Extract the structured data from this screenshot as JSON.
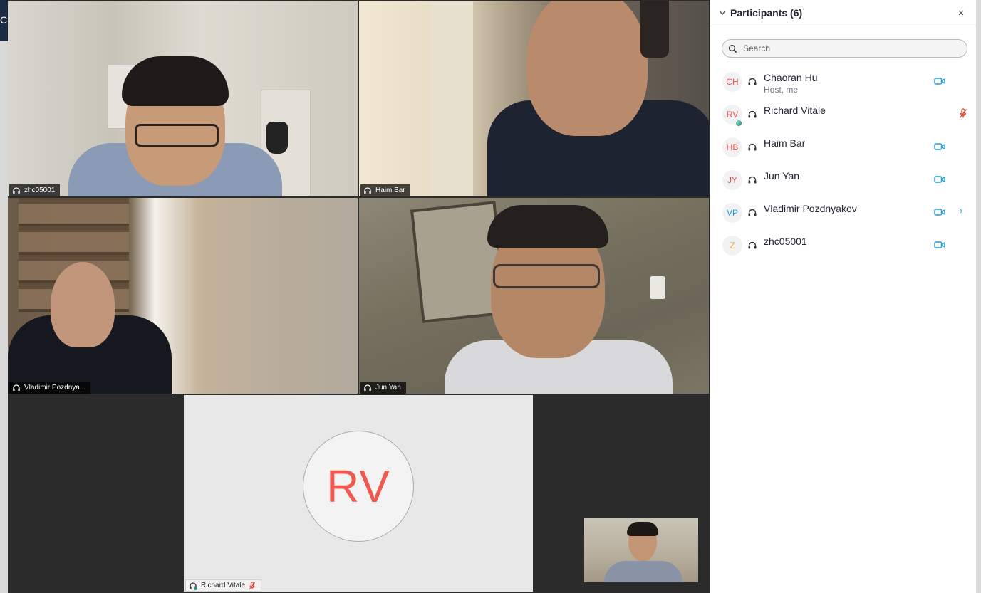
{
  "colors": {
    "accent": "#1a9fd9",
    "muted_red": "#e0382b",
    "avatar_red": "#ee5a50"
  },
  "gallery": {
    "tiles": [
      {
        "name": "zhc05001"
      },
      {
        "name": "Haim Bar"
      },
      {
        "name": "Vladimir Pozdnya..."
      },
      {
        "name": "Jun Yan"
      }
    ],
    "avatar_tile": {
      "initials": "RV",
      "name": "Richard Vitale"
    },
    "left_edge_glyph": "C"
  },
  "panel": {
    "title": "Participants (6)",
    "close_label": "×",
    "search_placeholder": "Search",
    "participants": [
      {
        "initials": "CH",
        "initials_color": "#e8574d",
        "name": "Chaoran Hu",
        "subtitle": "Host, me",
        "video": "on",
        "mic": "none"
      },
      {
        "initials": "RV",
        "initials_color": "#e8574d",
        "name": "Richard Vitale",
        "subtitle": "",
        "video": "none",
        "mic": "muted",
        "badge": true
      },
      {
        "initials": "HB",
        "initials_color": "#e8574d",
        "name": "Haim Bar",
        "subtitle": "",
        "video": "on",
        "mic": "none"
      },
      {
        "initials": "JY",
        "initials_color": "#e8574d",
        "name": "Jun Yan",
        "subtitle": "",
        "video": "on",
        "mic": "none"
      },
      {
        "initials": "VP",
        "initials_color": "#1a9fd9",
        "name": "Vladimir Pozdnyakov",
        "subtitle": "",
        "video": "on",
        "mic": "none",
        "more": "›"
      },
      {
        "initials": "Z",
        "initials_color": "#e8a13a",
        "name": "zhc05001",
        "subtitle": "",
        "video": "on",
        "mic": "none"
      }
    ]
  }
}
